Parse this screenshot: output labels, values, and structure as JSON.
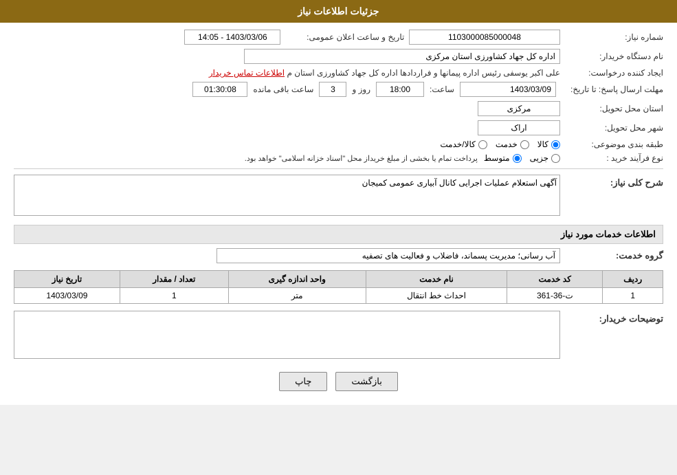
{
  "header": {
    "title": "جزئیات اطلاعات نیاز"
  },
  "fields": {
    "shomare_niaz_label": "شماره نیاز:",
    "shomare_niaz_value": "1103000085000048",
    "tarikh_label": "تاریخ و ساعت اعلان عمومی:",
    "tarikh_value": "1403/03/06 - 14:05",
    "name_dastgah_label": "نام دستگاه خریدار:",
    "name_dastgah_value": "اداره کل جهاد کشاورزی استان مرکزی",
    "ijad_konande_label": "ایجاد کننده درخواست:",
    "ijad_konande_value": "علی اکبر یوسفی رئیس اداره پیمانها و فراردادها اداره کل جهاد کشاورزی استان م",
    "link_tamas": "اطلاعات تماس خریدار",
    "mohlat_label": "مهلت ارسال پاسخ: تا تاریخ:",
    "mohlat_date": "1403/03/09",
    "mohlat_saat_label": "ساعت:",
    "mohlat_saat": "18:00",
    "mohlat_rooz_label": "روز و",
    "mohlat_rooz": "3",
    "mohlat_mande_label": "ساعت باقی مانده",
    "mohlat_mande": "01:30:08",
    "ostan_label": "استان محل تحویل:",
    "ostan_value": "مرکزی",
    "shahr_label": "شهر محل تحویل:",
    "shahr_value": "اراک",
    "tabaqe_label": "طبقه بندی موضوعی:",
    "tabaqe_options": [
      "کالا",
      "خدمت",
      "کالا/خدمت"
    ],
    "tabaqe_selected": "کالا",
    "process_label": "نوع فرآیند خرید :",
    "process_options": [
      "جزیی",
      "متوسط"
    ],
    "process_note": "پرداخت تمام یا بخشی از مبلغ خریداز محل \"اسناد خزانه اسلامی\" خواهد بود.",
    "sharh_label": "شرح کلی نیاز:",
    "sharh_value": "آگهی استعلام عملیات اجرایی کانال آبیاری عمومی کمیجان",
    "info_section_title": "اطلاعات خدمات مورد نیاز",
    "group_service_label": "گروه خدمت:",
    "group_service_value": "آب رسانی؛ مدیریت پسماند، فاضلاب و فعالیت های تصفیه",
    "table": {
      "headers": [
        "ردیف",
        "کد خدمت",
        "نام خدمت",
        "واحد اندازه گیری",
        "تعداد / مقدار",
        "تاریخ نیاز"
      ],
      "rows": [
        {
          "radif": "1",
          "code": "ت-36-361",
          "name": "احداث خط انتقال",
          "unit": "متر",
          "count": "1",
          "date": "1403/03/09"
        }
      ]
    },
    "tozihat_label": "توضیحات خریدار:"
  },
  "buttons": {
    "print_label": "چاپ",
    "back_label": "بازگشت"
  }
}
